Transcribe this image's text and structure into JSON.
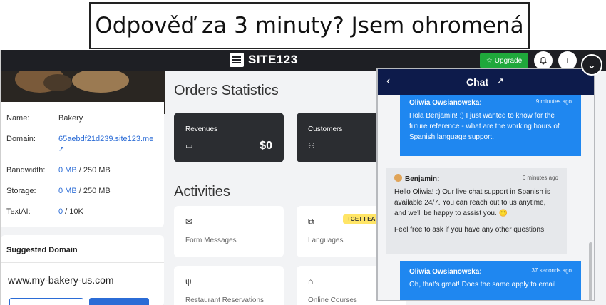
{
  "caption": "Odpověď za 3 minuty? Jsem ohromená",
  "topbar": {
    "logo_text": "SITE123",
    "upgrade_label": "Upgrade",
    "upgrade_icon": "star-icon",
    "bell_icon": "bell-icon",
    "plus_label": "+"
  },
  "sidebar": {
    "info": [
      {
        "key": "Name:",
        "value": "Bakery"
      },
      {
        "key": "Domain:",
        "value": "65aebdf21d239.site123.me"
      },
      {
        "key": "Bandwidth:",
        "link": "0 MB",
        "value": " / 250 MB"
      },
      {
        "key": "Storage:",
        "link": "0 MB",
        "value": " / 250 MB"
      },
      {
        "key": "TextAI:",
        "link": "0",
        "value": " / 10K"
      }
    ],
    "suggested_title": "Suggested Domain",
    "suggested_domain": "www.my-bakery-us.com"
  },
  "main": {
    "orders_title": "Orders Statistics",
    "stats": [
      {
        "label": "Revenues",
        "value": "$0",
        "icon": "money-icon"
      },
      {
        "label": "Customers",
        "value": "",
        "icon": "users-icon"
      }
    ],
    "activities_title": "Activities",
    "activities": [
      {
        "label": "Form Messages",
        "icon": "envelope-icon"
      },
      {
        "label": "Languages",
        "icon": "translate-icon",
        "badge": "+GET FEATURE"
      },
      {
        "label": "Restaurant Reservations",
        "icon": "fork-knife-icon"
      },
      {
        "label": "Online Courses",
        "icon": "graduation-cap-icon"
      }
    ]
  },
  "chat": {
    "title": "Chat",
    "messages": [
      {
        "from": "Oliwia Owsianowska:",
        "time": "9 minutes ago",
        "text": "Hola Benjamin! :) I just wanted to know for the future reference - what are the working hours of Spanish language support."
      },
      {
        "from": "Benjamin:",
        "time": "6 minutes ago",
        "text": "Hello Oliwia! :) Our live chat support in Spanish is available 24/7. You can reach out to us anytime, and we'll be happy to assist you. 🙂",
        "text2": "Feel free to ask if you have any other questions!"
      },
      {
        "from": "Oliwia Owsianowska:",
        "time": "37 seconds ago",
        "text": "Oh, that's great! Does the same apply to email"
      }
    ],
    "close_label": "⌄"
  }
}
